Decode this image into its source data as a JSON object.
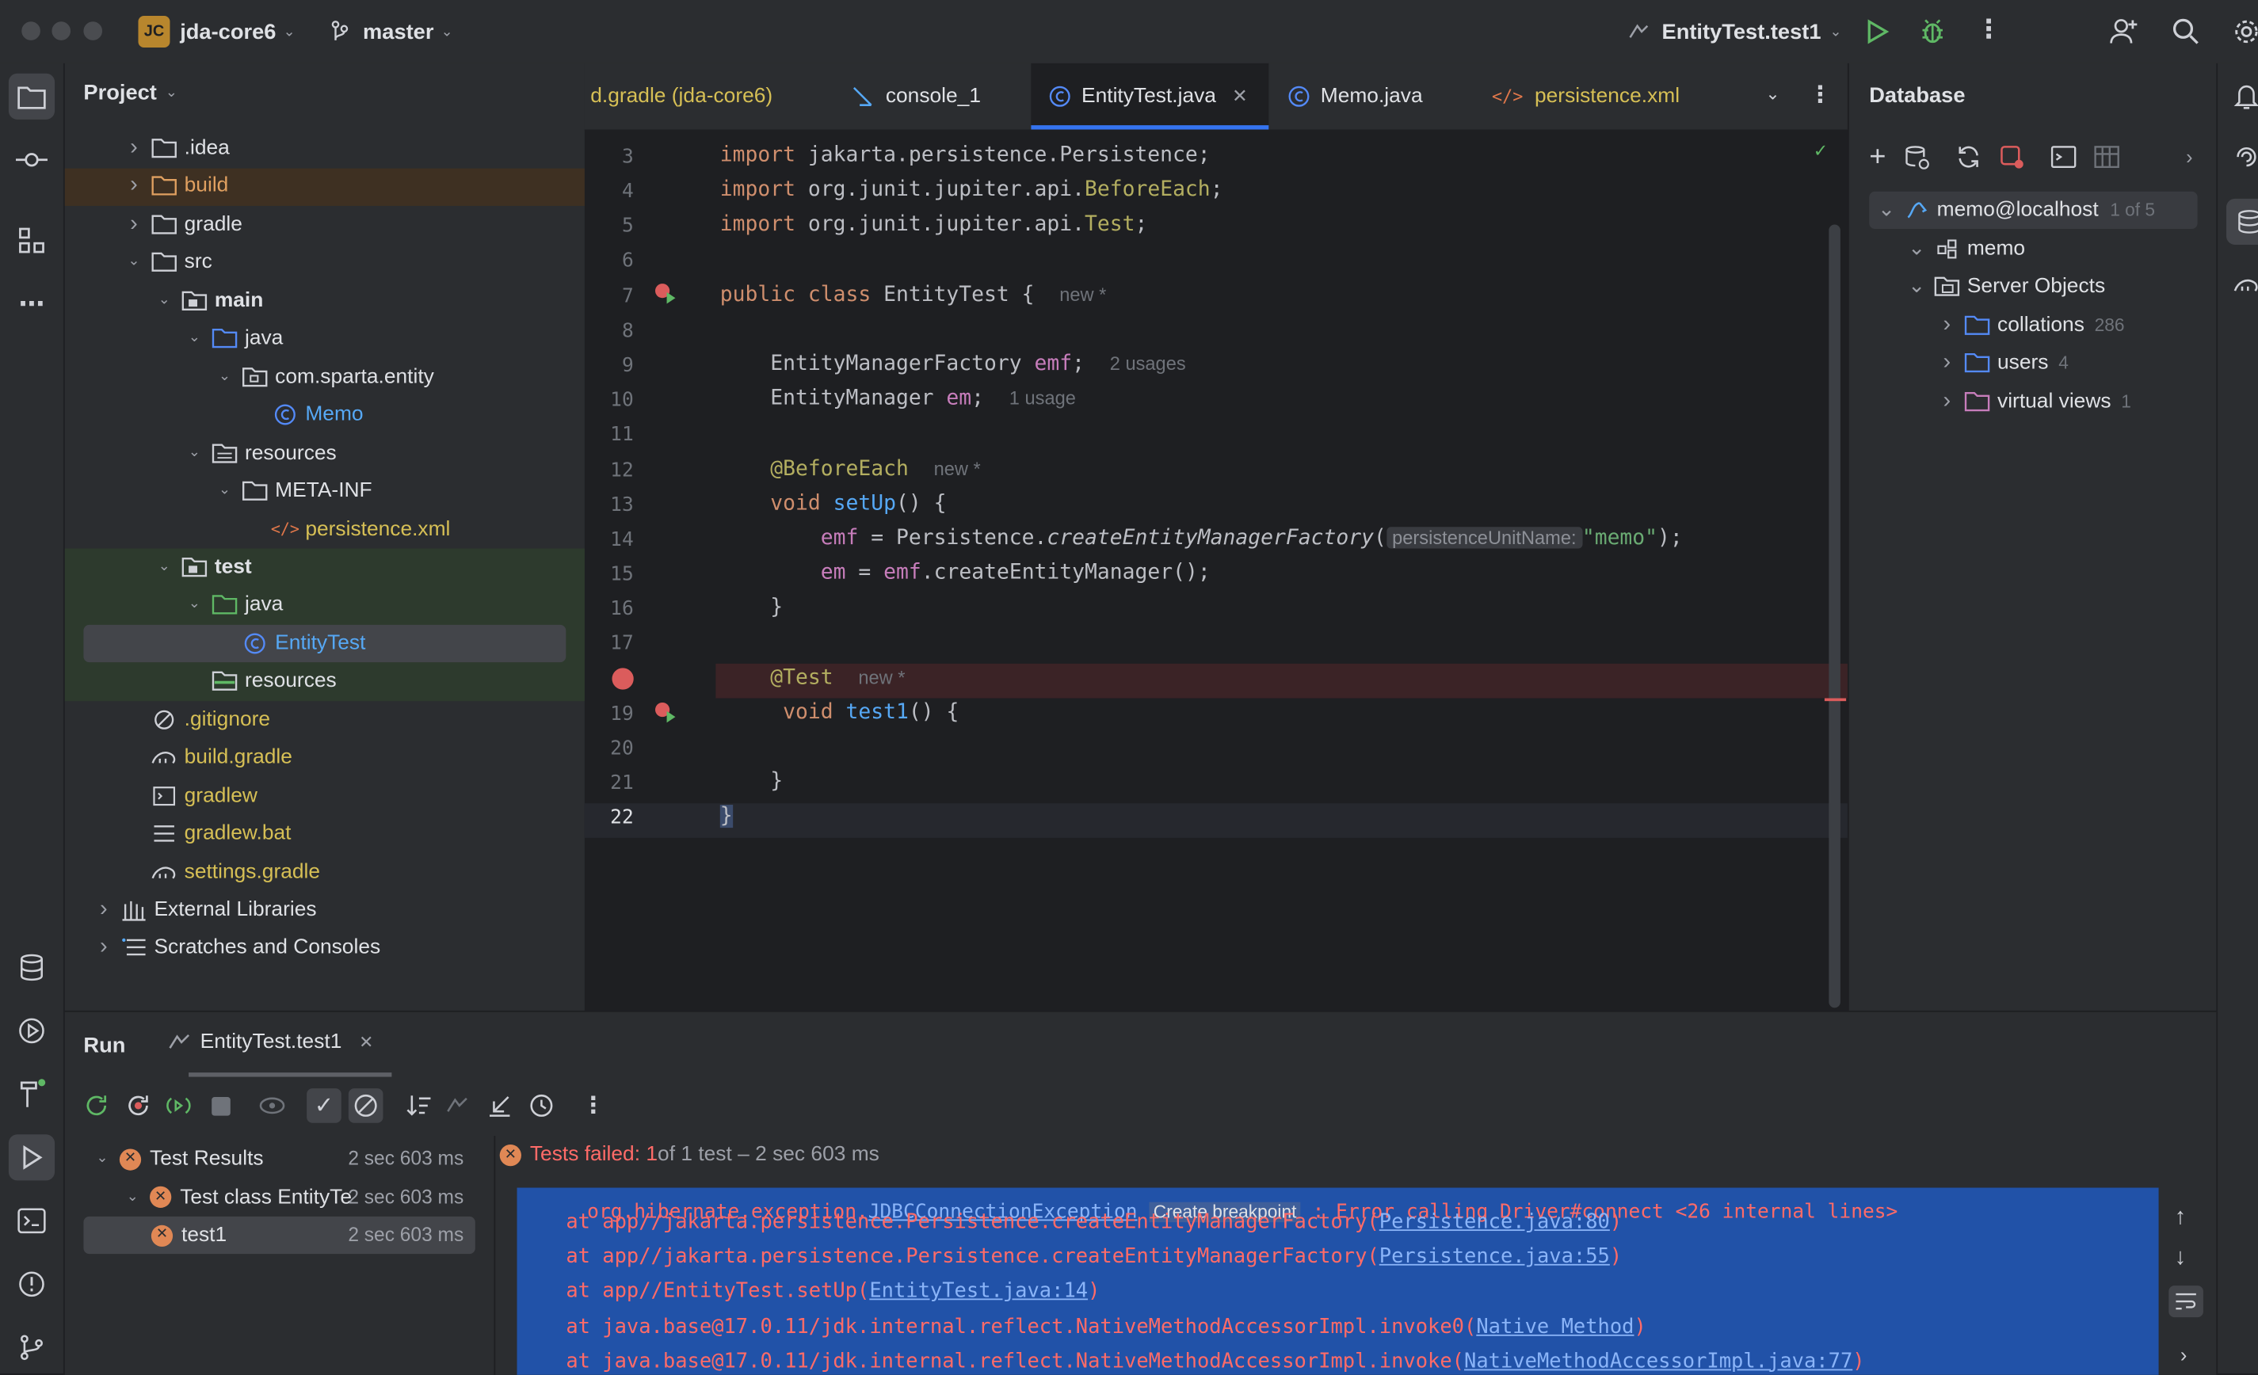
{
  "titlebar": {
    "project_badge": "JC",
    "project_name": "jda-core6",
    "branch": "master",
    "run_config": "EntityTest.test1"
  },
  "project_panel": {
    "title": "Project",
    "tree": [
      {
        "label": ".idea"
      },
      {
        "label": "build"
      },
      {
        "label": "gradle"
      },
      {
        "label": "src"
      },
      {
        "label": "main"
      },
      {
        "label": "java"
      },
      {
        "label": "com.sparta.entity"
      },
      {
        "label": "Memo"
      },
      {
        "label": "resources"
      },
      {
        "label": "META-INF"
      },
      {
        "label": "persistence.xml"
      },
      {
        "label": "test"
      },
      {
        "label": "java"
      },
      {
        "label": "EntityTest"
      },
      {
        "label": "resources"
      },
      {
        "label": ".gitignore"
      },
      {
        "label": "build.gradle"
      },
      {
        "label": "gradlew"
      },
      {
        "label": "gradlew.bat"
      },
      {
        "label": "settings.gradle"
      },
      {
        "label": "External Libraries"
      },
      {
        "label": "Scratches and Consoles"
      }
    ]
  },
  "tabs": [
    {
      "label": "d.gradle (jda-core6)"
    },
    {
      "label": "console_1"
    },
    {
      "label": "EntityTest.java",
      "active": true
    },
    {
      "label": "Memo.java"
    },
    {
      "label": "persistence.xml"
    }
  ],
  "editor": {
    "line_numbers": [
      "3",
      "4",
      "5",
      "6",
      "7",
      "8",
      "9",
      "10",
      "11",
      "12",
      "13",
      "14",
      "15",
      "16",
      "17",
      "",
      "19",
      "20",
      "21",
      "22"
    ],
    "code": {
      "l3_kw": "import",
      "l3": " jakarta.persistence.Persistence;",
      "l4_kw": "import",
      "l4_a": " org.junit.jupiter.api.",
      "l4_b": "BeforeEach",
      "l4_c": ";",
      "l5_kw": "import",
      "l5_a": " org.junit.jupiter.api.",
      "l5_b": "Test",
      "l5_c": ";",
      "l7_kw": "public class",
      "l7_a": " EntityTest ",
      "l7_b": "{",
      "l7_hint": "new *",
      "l9_a": "EntityManagerFactory ",
      "l9_b": "emf",
      "l9_c": ";",
      "l9_hint": "2 usages",
      "l10_a": "EntityManager ",
      "l10_b": "em",
      "l10_c": ";",
      "l10_hint": "1 usage",
      "l12_ann": "@BeforeEach",
      "l12_hint": "new *",
      "l13_kw": "void",
      "l13_fn": " setUp",
      "l13_a": "() {",
      "l14_a": "emf",
      "l14_b": " = Persistence.",
      "l14_c": "createEntityManagerFactory",
      "l14_d": "(",
      "l14_inlay": "persistenceUnitName:",
      "l14_str": "\"memo\"",
      "l14_e": ");",
      "l15_a": "em",
      "l15_b": " = ",
      "l15_c": "emf",
      "l15_d": ".createEntityManager();",
      "l16": "}",
      "l18_ann": "@Test",
      "l18_hint": "new *",
      "l19_kw": "void",
      "l19_fn": " test1",
      "l19_a": "() {",
      "l21": "}",
      "l22": "}"
    }
  },
  "database": {
    "title": "Database",
    "connection": "memo@localhost",
    "connection_badge": "1 of 5",
    "schema": "memo",
    "server_objects": "Server Objects",
    "items": [
      {
        "label": "collations",
        "count": "286"
      },
      {
        "label": "users",
        "count": "4"
      },
      {
        "label": "virtual views",
        "count": "1"
      }
    ]
  },
  "run_panel": {
    "title": "Run",
    "tab_label": "EntityTest.test1",
    "tests": [
      {
        "label": "Test Results",
        "time": "2 sec 603 ms"
      },
      {
        "label": "Test class EntityTe",
        "time": "2 sec 603 ms"
      },
      {
        "label": "test1",
        "time": "2 sec 603 ms"
      }
    ],
    "status_failed": "Tests failed: 1",
    "status_rest": " of 1 test – 2 sec 603 ms",
    "console": {
      "top_partial_a": "org.hibernate.exception.",
      "top_partial_link": "JDBCConnectionException",
      "top_partial_chip": "Create breakpoint",
      "top_partial_b": " : Error calling Driver#connect <26 internal lines>",
      "lines": [
        {
          "text": "at app//jakarta.persistence.Persistence.createEntityManagerFactory(",
          "link": "Persistence.java:80",
          "end": ")"
        },
        {
          "text": "at app//jakarta.persistence.Persistence.createEntityManagerFactory(",
          "link": "Persistence.java:55",
          "end": ")"
        },
        {
          "text": "at app//EntityTest.setUp(",
          "link": "EntityTest.java:14",
          "end": ")"
        },
        {
          "text": "at java.base@17.0.11/jdk.internal.reflect.NativeMethodAccessorImpl.invoke0(",
          "link": "Native Method",
          "end": ")"
        },
        {
          "text": "at java.base@17.0.11/jdk.internal.reflect.NativeMethodAccessorImpl.invoke(",
          "link": "NativeMethodAccessorImpl.java:77",
          "end": ")"
        }
      ]
    }
  }
}
